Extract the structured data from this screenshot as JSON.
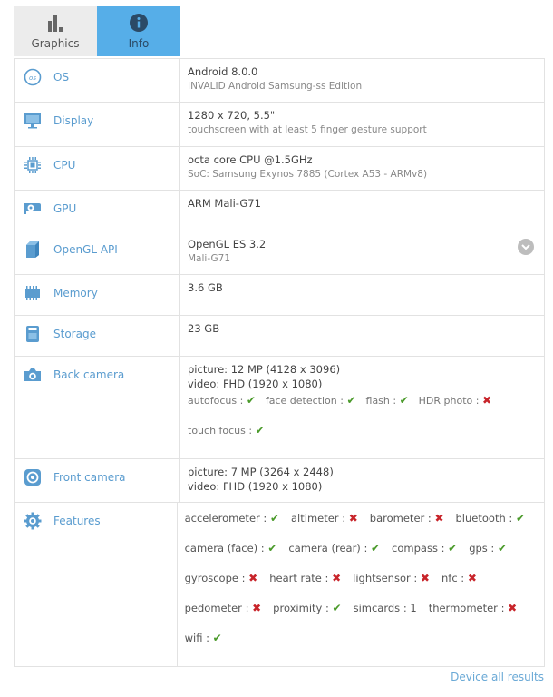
{
  "tabs": [
    {
      "label": "Graphics",
      "icon": "bar-chart-icon",
      "active": false
    },
    {
      "label": "Info",
      "icon": "info-icon",
      "active": true
    }
  ],
  "colors": {
    "accent": "#56aee8",
    "label": "#5a9ccf",
    "ok": "#4a9a2a",
    "no": "#c8242a"
  },
  "rows": {
    "os": {
      "label": "OS",
      "main": "Android 8.0.0",
      "sub": "INVALID Android Samsung-ss Edition"
    },
    "display": {
      "label": "Display",
      "main": "1280 x 720, 5.5\"",
      "sub": "touchscreen with at least 5 finger gesture support"
    },
    "cpu": {
      "label": "CPU",
      "main": "octa core CPU @1.5GHz",
      "sub": "SoC: Samsung Exynos 7885 (Cortex A53 - ARMv8)"
    },
    "gpu": {
      "label": "GPU",
      "main": "ARM Mali-G71"
    },
    "opengl": {
      "label": "OpenGL API",
      "main": "OpenGL ES 3.2",
      "sub": "Mali-G71"
    },
    "memory": {
      "label": "Memory",
      "main": "3.6 GB"
    },
    "storage": {
      "label": "Storage",
      "main": "23 GB"
    },
    "back_camera": {
      "label": "Back camera",
      "picture": "picture: 12 MP (4128 x 3096)",
      "video": "video: FHD (1920 x 1080)",
      "flags": [
        {
          "name": "autofocus :",
          "status": "✔",
          "ok": true
        },
        {
          "name": "face detection :",
          "status": "✔",
          "ok": true
        },
        {
          "name": "flash :",
          "status": "✔",
          "ok": true
        },
        {
          "name": "HDR photo :",
          "status": "✖",
          "ok": false
        },
        {
          "name": "touch focus :",
          "status": "✔",
          "ok": true
        }
      ]
    },
    "front_camera": {
      "label": "Front camera",
      "picture": "picture: 7 MP (3264 x 2448)",
      "video": "video: FHD (1920 x 1080)"
    },
    "features": {
      "label": "Features",
      "items": [
        {
          "name": "accelerometer :",
          "status": "✔",
          "ok": true
        },
        {
          "name": "altimeter :",
          "status": "✖",
          "ok": false
        },
        {
          "name": "barometer :",
          "status": "✖",
          "ok": false
        },
        {
          "name": "bluetooth :",
          "status": "✔",
          "ok": true
        },
        {
          "name": "camera (face) :",
          "status": "✔",
          "ok": true
        },
        {
          "name": "camera (rear) :",
          "status": "✔",
          "ok": true
        },
        {
          "name": "compass :",
          "status": "✔",
          "ok": true
        },
        {
          "name": "gps :",
          "status": "✔",
          "ok": true
        },
        {
          "name": "gyroscope :",
          "status": "✖",
          "ok": false
        },
        {
          "name": "heart rate :",
          "status": "✖",
          "ok": false
        },
        {
          "name": "lightsensor :",
          "status": "✖",
          "ok": false
        },
        {
          "name": "nfc :",
          "status": "✖",
          "ok": false
        },
        {
          "name": "pedometer :",
          "status": "✖",
          "ok": false
        },
        {
          "name": "proximity :",
          "status": "✔",
          "ok": true
        },
        {
          "name": "simcards :",
          "status": "1",
          "ok": null
        },
        {
          "name": "thermometer :",
          "status": "✖",
          "ok": false
        },
        {
          "name": "wifi :",
          "status": "✔",
          "ok": true
        }
      ]
    }
  },
  "footer": {
    "link": "Device all results"
  }
}
